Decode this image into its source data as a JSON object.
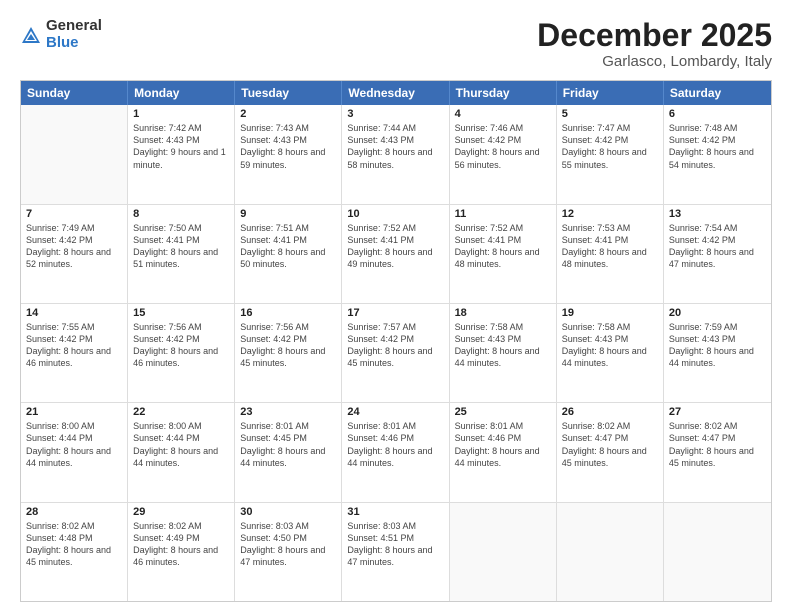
{
  "logo": {
    "general": "General",
    "blue": "Blue"
  },
  "title": {
    "month": "December 2025",
    "location": "Garlasco, Lombardy, Italy"
  },
  "header_days": [
    "Sunday",
    "Monday",
    "Tuesday",
    "Wednesday",
    "Thursday",
    "Friday",
    "Saturday"
  ],
  "weeks": [
    [
      {
        "day": "",
        "sunrise": "",
        "sunset": "",
        "daylight": ""
      },
      {
        "day": "1",
        "sunrise": "Sunrise: 7:42 AM",
        "sunset": "Sunset: 4:43 PM",
        "daylight": "Daylight: 9 hours and 1 minute."
      },
      {
        "day": "2",
        "sunrise": "Sunrise: 7:43 AM",
        "sunset": "Sunset: 4:43 PM",
        "daylight": "Daylight: 8 hours and 59 minutes."
      },
      {
        "day": "3",
        "sunrise": "Sunrise: 7:44 AM",
        "sunset": "Sunset: 4:43 PM",
        "daylight": "Daylight: 8 hours and 58 minutes."
      },
      {
        "day": "4",
        "sunrise": "Sunrise: 7:46 AM",
        "sunset": "Sunset: 4:42 PM",
        "daylight": "Daylight: 8 hours and 56 minutes."
      },
      {
        "day": "5",
        "sunrise": "Sunrise: 7:47 AM",
        "sunset": "Sunset: 4:42 PM",
        "daylight": "Daylight: 8 hours and 55 minutes."
      },
      {
        "day": "6",
        "sunrise": "Sunrise: 7:48 AM",
        "sunset": "Sunset: 4:42 PM",
        "daylight": "Daylight: 8 hours and 54 minutes."
      }
    ],
    [
      {
        "day": "7",
        "sunrise": "Sunrise: 7:49 AM",
        "sunset": "Sunset: 4:42 PM",
        "daylight": "Daylight: 8 hours and 52 minutes."
      },
      {
        "day": "8",
        "sunrise": "Sunrise: 7:50 AM",
        "sunset": "Sunset: 4:41 PM",
        "daylight": "Daylight: 8 hours and 51 minutes."
      },
      {
        "day": "9",
        "sunrise": "Sunrise: 7:51 AM",
        "sunset": "Sunset: 4:41 PM",
        "daylight": "Daylight: 8 hours and 50 minutes."
      },
      {
        "day": "10",
        "sunrise": "Sunrise: 7:52 AM",
        "sunset": "Sunset: 4:41 PM",
        "daylight": "Daylight: 8 hours and 49 minutes."
      },
      {
        "day": "11",
        "sunrise": "Sunrise: 7:52 AM",
        "sunset": "Sunset: 4:41 PM",
        "daylight": "Daylight: 8 hours and 48 minutes."
      },
      {
        "day": "12",
        "sunrise": "Sunrise: 7:53 AM",
        "sunset": "Sunset: 4:41 PM",
        "daylight": "Daylight: 8 hours and 48 minutes."
      },
      {
        "day": "13",
        "sunrise": "Sunrise: 7:54 AM",
        "sunset": "Sunset: 4:42 PM",
        "daylight": "Daylight: 8 hours and 47 minutes."
      }
    ],
    [
      {
        "day": "14",
        "sunrise": "Sunrise: 7:55 AM",
        "sunset": "Sunset: 4:42 PM",
        "daylight": "Daylight: 8 hours and 46 minutes."
      },
      {
        "day": "15",
        "sunrise": "Sunrise: 7:56 AM",
        "sunset": "Sunset: 4:42 PM",
        "daylight": "Daylight: 8 hours and 46 minutes."
      },
      {
        "day": "16",
        "sunrise": "Sunrise: 7:56 AM",
        "sunset": "Sunset: 4:42 PM",
        "daylight": "Daylight: 8 hours and 45 minutes."
      },
      {
        "day": "17",
        "sunrise": "Sunrise: 7:57 AM",
        "sunset": "Sunset: 4:42 PM",
        "daylight": "Daylight: 8 hours and 45 minutes."
      },
      {
        "day": "18",
        "sunrise": "Sunrise: 7:58 AM",
        "sunset": "Sunset: 4:43 PM",
        "daylight": "Daylight: 8 hours and 44 minutes."
      },
      {
        "day": "19",
        "sunrise": "Sunrise: 7:58 AM",
        "sunset": "Sunset: 4:43 PM",
        "daylight": "Daylight: 8 hours and 44 minutes."
      },
      {
        "day": "20",
        "sunrise": "Sunrise: 7:59 AM",
        "sunset": "Sunset: 4:43 PM",
        "daylight": "Daylight: 8 hours and 44 minutes."
      }
    ],
    [
      {
        "day": "21",
        "sunrise": "Sunrise: 8:00 AM",
        "sunset": "Sunset: 4:44 PM",
        "daylight": "Daylight: 8 hours and 44 minutes."
      },
      {
        "day": "22",
        "sunrise": "Sunrise: 8:00 AM",
        "sunset": "Sunset: 4:44 PM",
        "daylight": "Daylight: 8 hours and 44 minutes."
      },
      {
        "day": "23",
        "sunrise": "Sunrise: 8:01 AM",
        "sunset": "Sunset: 4:45 PM",
        "daylight": "Daylight: 8 hours and 44 minutes."
      },
      {
        "day": "24",
        "sunrise": "Sunrise: 8:01 AM",
        "sunset": "Sunset: 4:46 PM",
        "daylight": "Daylight: 8 hours and 44 minutes."
      },
      {
        "day": "25",
        "sunrise": "Sunrise: 8:01 AM",
        "sunset": "Sunset: 4:46 PM",
        "daylight": "Daylight: 8 hours and 44 minutes."
      },
      {
        "day": "26",
        "sunrise": "Sunrise: 8:02 AM",
        "sunset": "Sunset: 4:47 PM",
        "daylight": "Daylight: 8 hours and 45 minutes."
      },
      {
        "day": "27",
        "sunrise": "Sunrise: 8:02 AM",
        "sunset": "Sunset: 4:47 PM",
        "daylight": "Daylight: 8 hours and 45 minutes."
      }
    ],
    [
      {
        "day": "28",
        "sunrise": "Sunrise: 8:02 AM",
        "sunset": "Sunset: 4:48 PM",
        "daylight": "Daylight: 8 hours and 45 minutes."
      },
      {
        "day": "29",
        "sunrise": "Sunrise: 8:02 AM",
        "sunset": "Sunset: 4:49 PM",
        "daylight": "Daylight: 8 hours and 46 minutes."
      },
      {
        "day": "30",
        "sunrise": "Sunrise: 8:03 AM",
        "sunset": "Sunset: 4:50 PM",
        "daylight": "Daylight: 8 hours and 47 minutes."
      },
      {
        "day": "31",
        "sunrise": "Sunrise: 8:03 AM",
        "sunset": "Sunset: 4:51 PM",
        "daylight": "Daylight: 8 hours and 47 minutes."
      },
      {
        "day": "",
        "sunrise": "",
        "sunset": "",
        "daylight": ""
      },
      {
        "day": "",
        "sunrise": "",
        "sunset": "",
        "daylight": ""
      },
      {
        "day": "",
        "sunrise": "",
        "sunset": "",
        "daylight": ""
      }
    ]
  ]
}
